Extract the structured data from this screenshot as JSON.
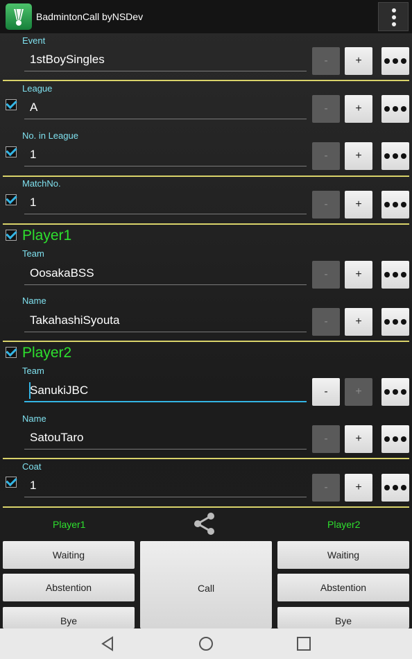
{
  "app": {
    "title": "BadmintonCall byNSDev",
    "icon": "shuttlecock-icon"
  },
  "fields": [
    {
      "key": "event",
      "label": "Event",
      "value": "1stBoySingles",
      "checked": null
    },
    {
      "key": "league",
      "label": "League",
      "value": "A",
      "checked": true
    },
    {
      "key": "no_in_league",
      "label": "No. in League",
      "value": "1",
      "checked": true
    },
    {
      "key": "match_no",
      "label": "MatchNo.",
      "value": "1",
      "checked": true
    },
    {
      "key": "p1_team",
      "label": "Team",
      "value": "OosakaBSS",
      "checked": null
    },
    {
      "key": "p1_name",
      "label": "Name",
      "value": "TakahashiSyouta",
      "checked": null
    },
    {
      "key": "p2_team",
      "label": "Team",
      "value": "SanukiJBC",
      "checked": null
    },
    {
      "key": "p2_name",
      "label": "Name",
      "value": "SatouTaro",
      "checked": null
    },
    {
      "key": "coat",
      "label": "Coat",
      "value": "1",
      "checked": true
    }
  ],
  "players": {
    "p1_heading": "Player1",
    "p2_heading": "Player2",
    "p1_checked": true,
    "p2_checked": true
  },
  "buttons": {
    "minus": "-",
    "plus": "+"
  },
  "bottom": {
    "player1_label": "Player1",
    "player2_label": "Player2",
    "share_icon": "share-icon",
    "waiting": "Waiting",
    "abstention": "Abstention",
    "bye": "Bye",
    "call": "Call"
  },
  "colors": {
    "accent": "#33b5e5",
    "player_green": "#2ee02e",
    "separator": "#d9d36a",
    "label_cyan": "#7fe0ee"
  }
}
